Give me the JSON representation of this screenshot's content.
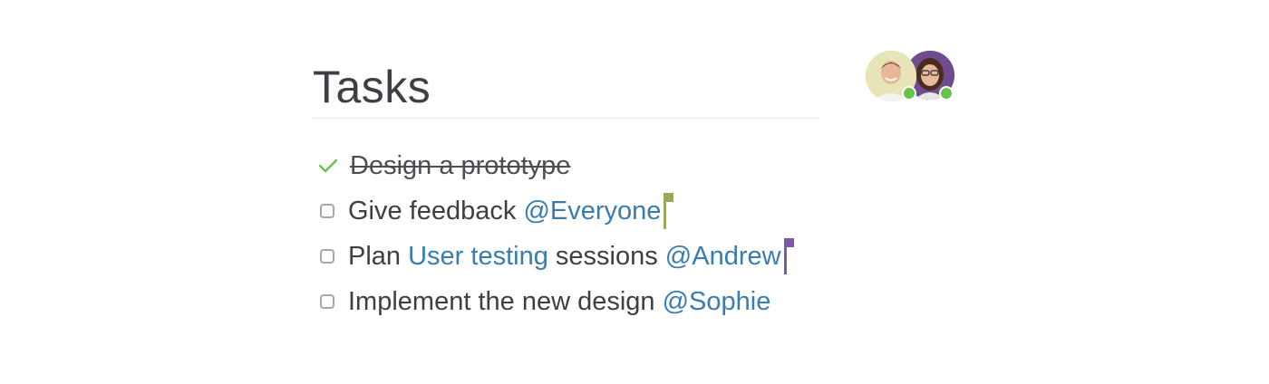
{
  "page": {
    "title": "Tasks"
  },
  "collaborators": [
    {
      "name": "avatar-man",
      "online": true,
      "bg": "#e8e4b8"
    },
    {
      "name": "avatar-woman",
      "online": true,
      "bg": "#6e4c8f"
    }
  ],
  "colors": {
    "mention": "#3a7cb0",
    "check": "#66c44b",
    "flag_green": "#9aa85a",
    "flag_purple": "#7b58a8"
  },
  "tasks": [
    {
      "done": true,
      "parts": [
        "Design a prototype"
      ]
    },
    {
      "done": false,
      "text": "Give feedback ",
      "mention": "@Everyone",
      "flag": "green"
    },
    {
      "done": false,
      "text": "Plan ",
      "link": "User testing",
      "text2": " sessions ",
      "mention": "@Andrew",
      "flag": "purple"
    },
    {
      "done": false,
      "text": "Implement the new design ",
      "mention": "@Sophie"
    }
  ]
}
